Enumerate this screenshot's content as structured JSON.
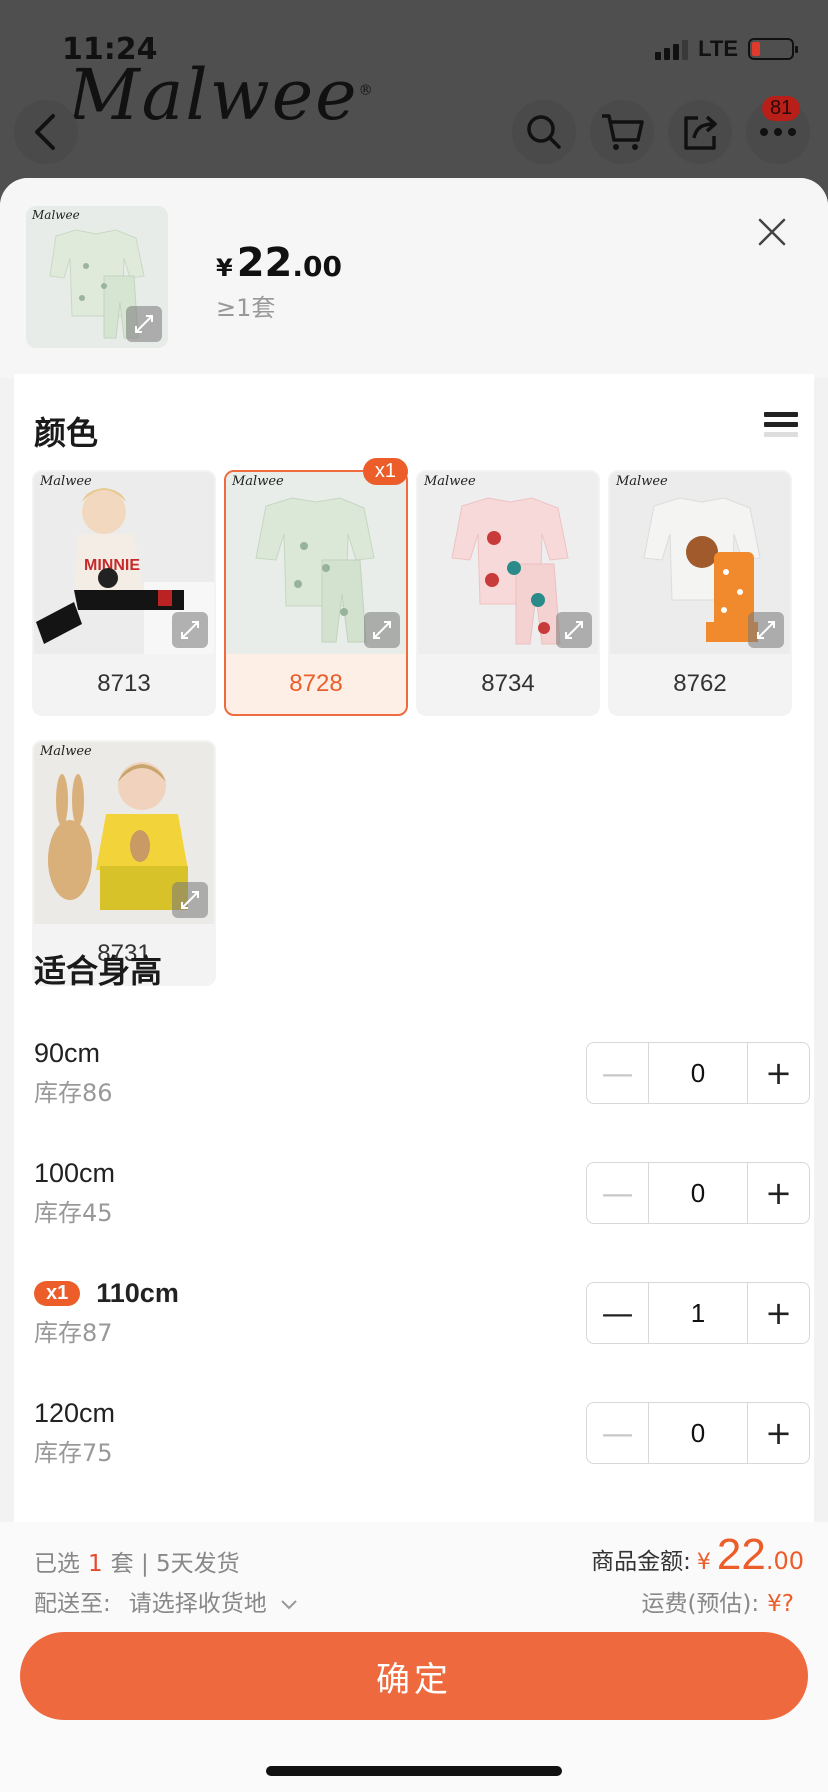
{
  "status": {
    "time": "11:24",
    "network": "LTE"
  },
  "brand": {
    "logo_text": "Malwee",
    "reg": "®"
  },
  "nav": {
    "cart_badge": "81"
  },
  "product": {
    "price_currency": "¥",
    "price_int": "22",
    "price_dec": ".00",
    "moq": "≥1套"
  },
  "color_section": {
    "title": "颜色",
    "options": [
      {
        "label": "8713",
        "selected": false,
        "count_badge": ""
      },
      {
        "label": "8728",
        "selected": true,
        "count_badge": "x1"
      },
      {
        "label": "8734",
        "selected": false,
        "count_badge": ""
      },
      {
        "label": "8762",
        "selected": false,
        "count_badge": ""
      },
      {
        "label": "8731",
        "selected": false,
        "count_badge": ""
      }
    ]
  },
  "size_section": {
    "title": "适合身高",
    "rows": [
      {
        "size": "90cm",
        "stock": "库存86",
        "qty": "0",
        "tag": ""
      },
      {
        "size": "100cm",
        "stock": "库存45",
        "qty": "0",
        "tag": ""
      },
      {
        "size": "110cm",
        "stock": "库存87",
        "qty": "1",
        "tag": "x1"
      },
      {
        "size": "120cm",
        "stock": "库存75",
        "qty": "0",
        "tag": ""
      }
    ],
    "minus": "—",
    "plus": "+"
  },
  "footer": {
    "selected_prefix": "已选",
    "selected_count": "1",
    "selected_suffix": "套 | 5天发货",
    "ship_to_label": "配送至:",
    "ship_to_value": "请选择收货地",
    "amount_label": "商品金额:",
    "amount_currency": "¥",
    "amount_int": "22",
    "amount_dec": ".00",
    "freight_label": "运费(预估):",
    "freight_value": "¥?",
    "confirm_label": "确定"
  },
  "colors": {
    "accent": "#ee6a3e",
    "accent_text": "#e8602c"
  }
}
